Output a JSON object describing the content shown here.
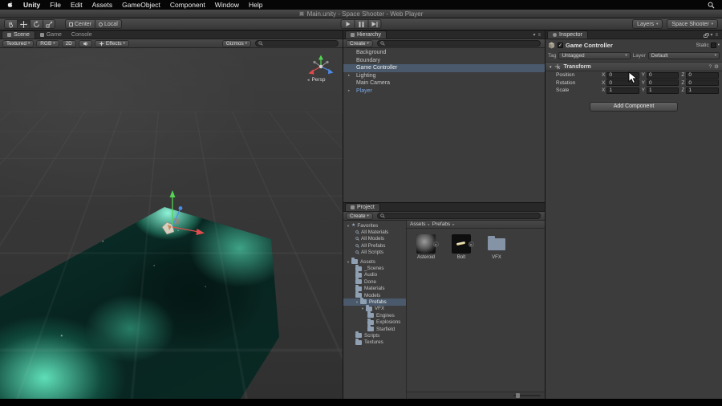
{
  "menubar": {
    "items": [
      "Unity",
      "File",
      "Edit",
      "Assets",
      "GameObject",
      "Component",
      "Window",
      "Help"
    ]
  },
  "titlebar": {
    "title": "Main.unity - Space Shooter - Web Player"
  },
  "toolbar": {
    "pivot": "Center",
    "space": "Local",
    "layers": "Layers",
    "layout": "Space Shooter"
  },
  "scene": {
    "tab_scene": "Scene",
    "tab_game": "Game",
    "tab_console": "Console",
    "render_mode": "Textured",
    "channels": "RGB",
    "mode_2d": "2D",
    "effects": "Effects",
    "gizmos": "Gizmos",
    "persp": "Persp"
  },
  "hierarchy": {
    "tab": "Hierarchy",
    "create": "Create",
    "items": [
      {
        "label": "Background"
      },
      {
        "label": "Boundary"
      },
      {
        "label": "Game Controller"
      },
      {
        "label": "Lighting"
      },
      {
        "label": "Main Camera"
      },
      {
        "label": "Player"
      }
    ]
  },
  "project": {
    "tab": "Project",
    "create": "Create",
    "favorites_label": "Favorites",
    "favorites": [
      "All Materials",
      "All Models",
      "All Prefabs",
      "All Scripts"
    ],
    "assets_label": "Assets",
    "folders": [
      "_Scenes",
      "Audio",
      "Done",
      "Materials",
      "Models",
      "Prefabs",
      "VFX",
      "Engines",
      "Explosions",
      "Starfield",
      "Scripts",
      "Textures"
    ],
    "breadcrumb": [
      "Assets",
      "Prefabs"
    ],
    "assets": [
      "Asteroid",
      "Bolt",
      "VFX"
    ]
  },
  "inspector": {
    "tab": "Inspector",
    "name": "Game Controller",
    "static": "Static",
    "tag_label": "Tag",
    "tag_value": "Untagged",
    "layer_label": "Layer",
    "layer_value": "Default",
    "transform": {
      "title": "Transform",
      "axis": [
        "X",
        "Y",
        "Z"
      ],
      "rows": [
        {
          "label": "Position",
          "x": "0",
          "y": "0",
          "z": "0"
        },
        {
          "label": "Rotation",
          "x": "0",
          "y": "0",
          "z": "0"
        },
        {
          "label": "Scale",
          "x": "1",
          "y": "1",
          "z": "1"
        }
      ]
    },
    "add_component": "Add Component"
  },
  "icons": {
    "dropdown": "▾",
    "fold_open": "▼",
    "fold_closed": "▸",
    "breadcrumb_sep": "▸",
    "star": "★",
    "check": "✓",
    "gear": "⚙",
    "menu": "≡",
    "help": "?",
    "persp_arrow": "◄"
  },
  "colors": {
    "selection": "#4a5a6c",
    "prefab_text": "#7aa8e8",
    "axis_x": "#e04c4c",
    "axis_y": "#53d453",
    "axis_z": "#4b8be8"
  }
}
